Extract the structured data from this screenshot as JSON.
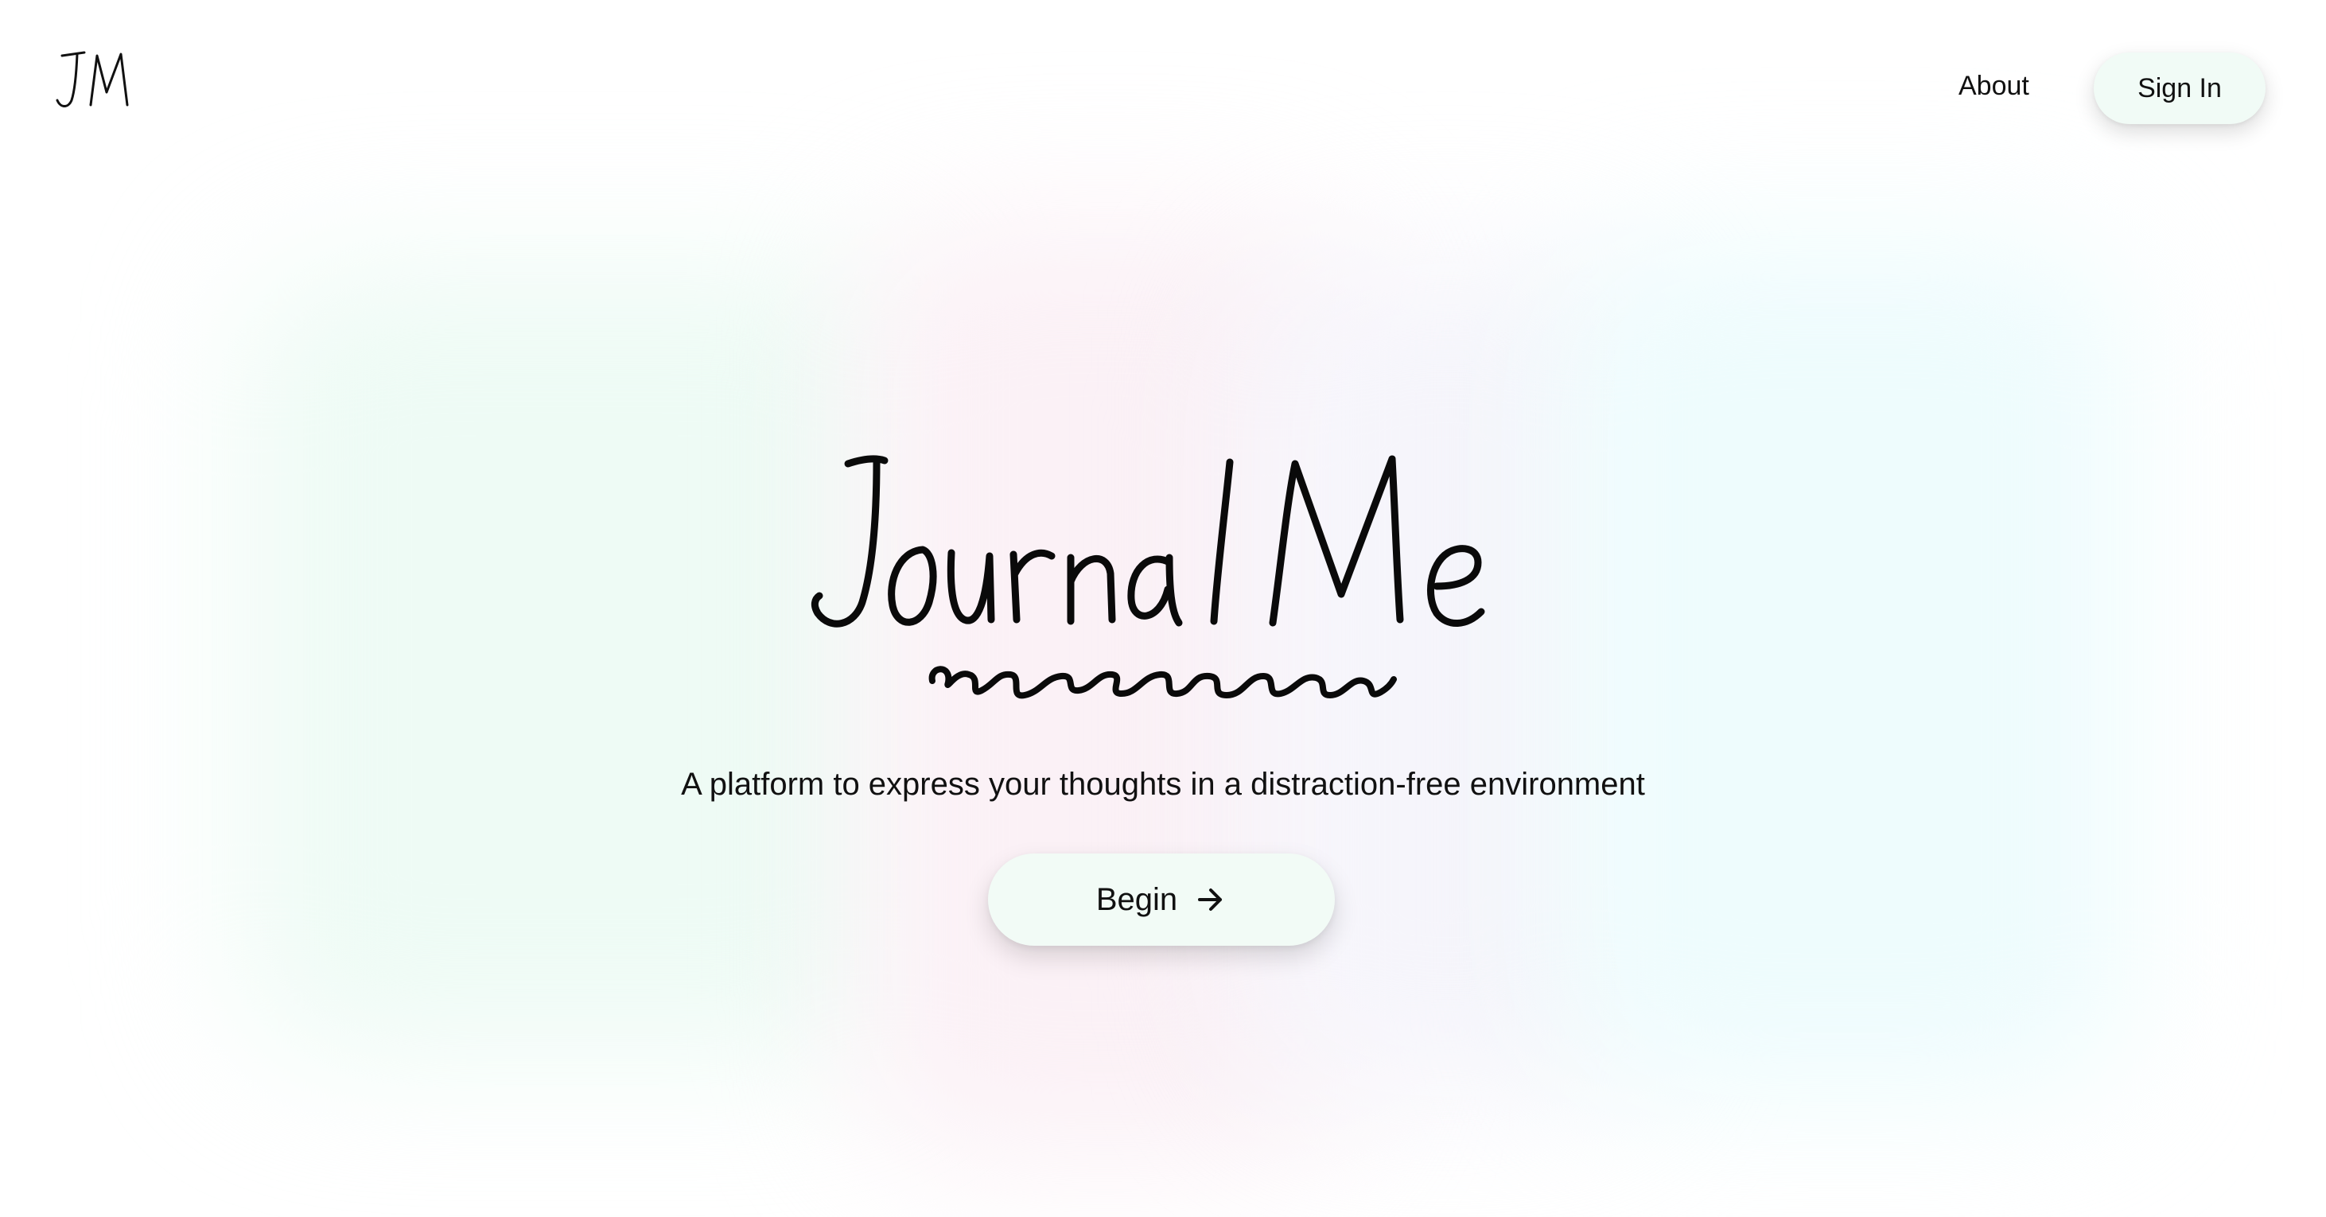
{
  "header": {
    "logo_text": "JM",
    "nav": {
      "about_label": "About"
    },
    "signin_label": "Sign In"
  },
  "hero": {
    "title": "Journal Me",
    "tagline": "A platform to express your thoughts in a distraction-free environment",
    "begin_label": "Begin",
    "begin_icon": "arrow-right-icon"
  },
  "colors": {
    "button_bg": "#f1fbf6",
    "text": "#111111",
    "glow_mint": "#eefbf5",
    "glow_pink": "#fbf1f6",
    "glow_cyan": "#eefcfd"
  }
}
